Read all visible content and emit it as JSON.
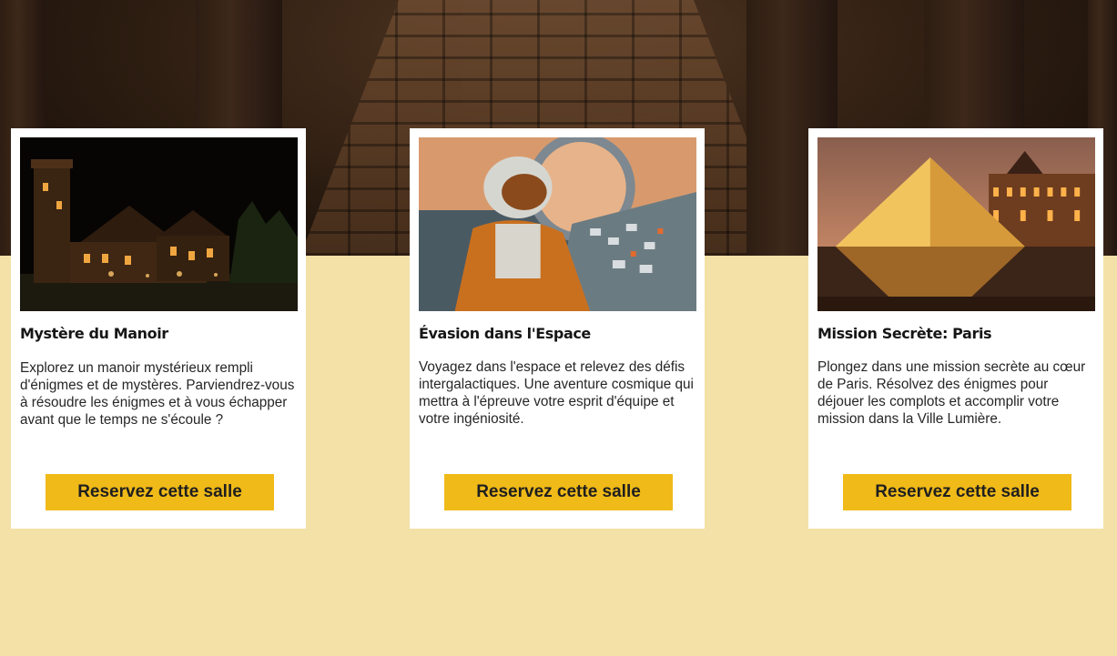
{
  "hero": {
    "image": "stone-walkway-between-pillars"
  },
  "cards": [
    {
      "title": "Mystère du Manoir",
      "description": "Explorez un manoir mystérieux rempli d'énigmes et de mystères. Parviendrez-vous à résoudre les énigmes et à vous échapper avant que le temps ne s'écoule ?",
      "button_label": "Reservez cette salle",
      "image": "haunted-manor-at-night"
    },
    {
      "title": "Évasion dans l'Espace",
      "description": "Voyagez dans l'espace et relevez des défis intergalactiques. Une aventure cosmique qui mettra à l'épreuve votre esprit d'équipe et votre ingéniosité.",
      "button_label": "Reservez cette salle",
      "image": "astronaut-in-spaceship-cockpit"
    },
    {
      "title": "Mission Secrète: Paris",
      "description": "Plongez dans une mission secrète au cœur de Paris. Résolvez des énigmes pour déjouer les complots et accomplir votre mission dans la Ville Lumière.",
      "button_label": "Reservez cette salle",
      "image": "louvre-pyramid-at-dusk"
    }
  ],
  "colors": {
    "page_background": "#f3e1a8",
    "card_background": "#ffffff",
    "button_background": "#f0ba18",
    "text": "#161616"
  }
}
